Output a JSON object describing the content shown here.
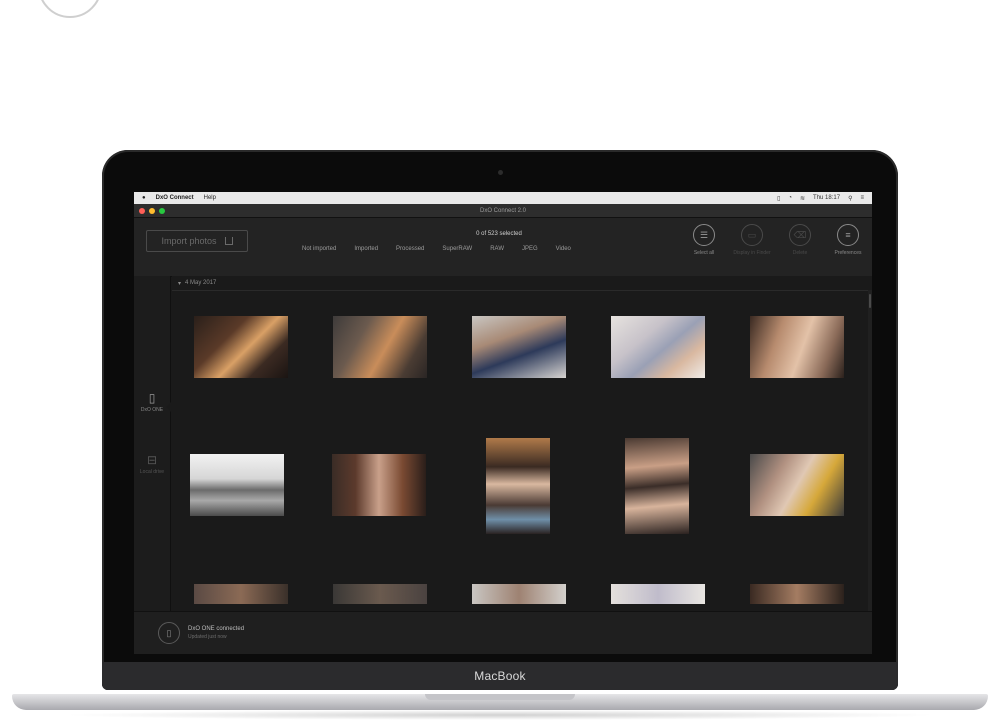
{
  "menubar": {
    "apple": "",
    "app_name": "DxO Connect",
    "menu_help": "Help",
    "clock": "Thu 18:17"
  },
  "window": {
    "title": "DxO Connect 2.0"
  },
  "toolbar": {
    "import_label": "Import photos",
    "selected_count": "0 of 523 selected",
    "filters": [
      "Not imported",
      "Imported",
      "Processed",
      "SuperRAW",
      "RAW",
      "JPEG",
      "Video"
    ],
    "tools": [
      {
        "label": "Select all",
        "icon": "select-all-icon",
        "enabled": true
      },
      {
        "label": "Display in Finder",
        "icon": "finder-icon",
        "enabled": false
      },
      {
        "label": "Delete",
        "icon": "trash-icon",
        "enabled": false
      },
      {
        "label": "Preferences",
        "icon": "preferences-icon",
        "enabled": true
      }
    ]
  },
  "sidebar": {
    "devices": [
      {
        "label": "DxO ONE",
        "icon": "camera-device-icon",
        "active": true
      },
      {
        "label": "Local drive",
        "icon": "drive-icon",
        "active": false
      }
    ]
  },
  "content": {
    "date_label": "4 May 2017"
  },
  "footer": {
    "status": "DxO ONE connected",
    "substatus": "Updated just now"
  },
  "device_label": "MacBook",
  "colors": {
    "light_red": "#ff5f57",
    "light_yellow": "#febc2e",
    "light_green": "#28c840"
  }
}
